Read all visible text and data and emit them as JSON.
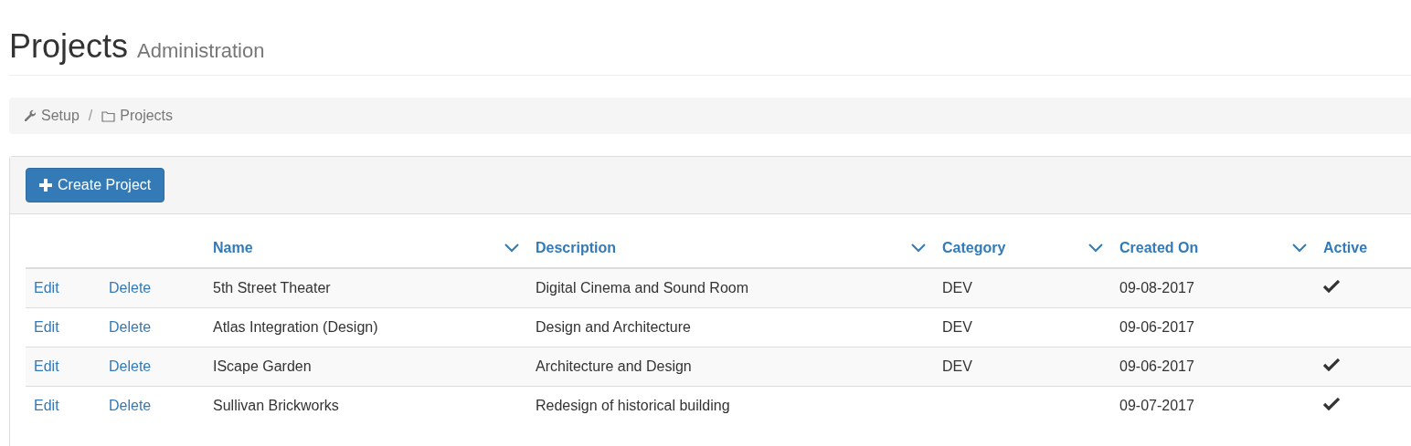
{
  "header": {
    "title": "Projects",
    "subtitle": "Administration"
  },
  "breadcrumb": [
    {
      "label": "Setup"
    },
    {
      "separator": "/",
      "label": "Projects"
    }
  ],
  "create_button": {
    "label": "Create Project"
  },
  "table": {
    "columns": [
      {
        "label": "Name",
        "sortable": true
      },
      {
        "label": "Description",
        "sortable": true
      },
      {
        "label": "Category",
        "sortable": true
      },
      {
        "label": "Created On",
        "sortable": true
      },
      {
        "label": "Active",
        "sortable": false
      }
    ],
    "rows": [
      {
        "actions": [
          "Edit",
          "Delete"
        ],
        "name": "5th Street Theater",
        "description": "Digital Cinema and Sound Room",
        "category": "DEV",
        "created_on": "09-08-2017",
        "active": true
      },
      {
        "actions": [
          "Edit",
          "Delete"
        ],
        "name": "Atlas Integration (Design)",
        "description": "Design and Architecture",
        "category": "DEV",
        "created_on": "09-06-2017",
        "active": false
      },
      {
        "actions": [
          "Edit",
          "Delete"
        ],
        "name": "IScape Garden",
        "description": "Architecture and Design",
        "category": "DEV",
        "created_on": "09-06-2017",
        "active": true
      },
      {
        "actions": [
          "Edit",
          "Delete"
        ],
        "name": "Sullivan Brickworks",
        "description": "Redesign of historical building",
        "created_on": "09-07-2017",
        "active": true
      }
    ]
  }
}
